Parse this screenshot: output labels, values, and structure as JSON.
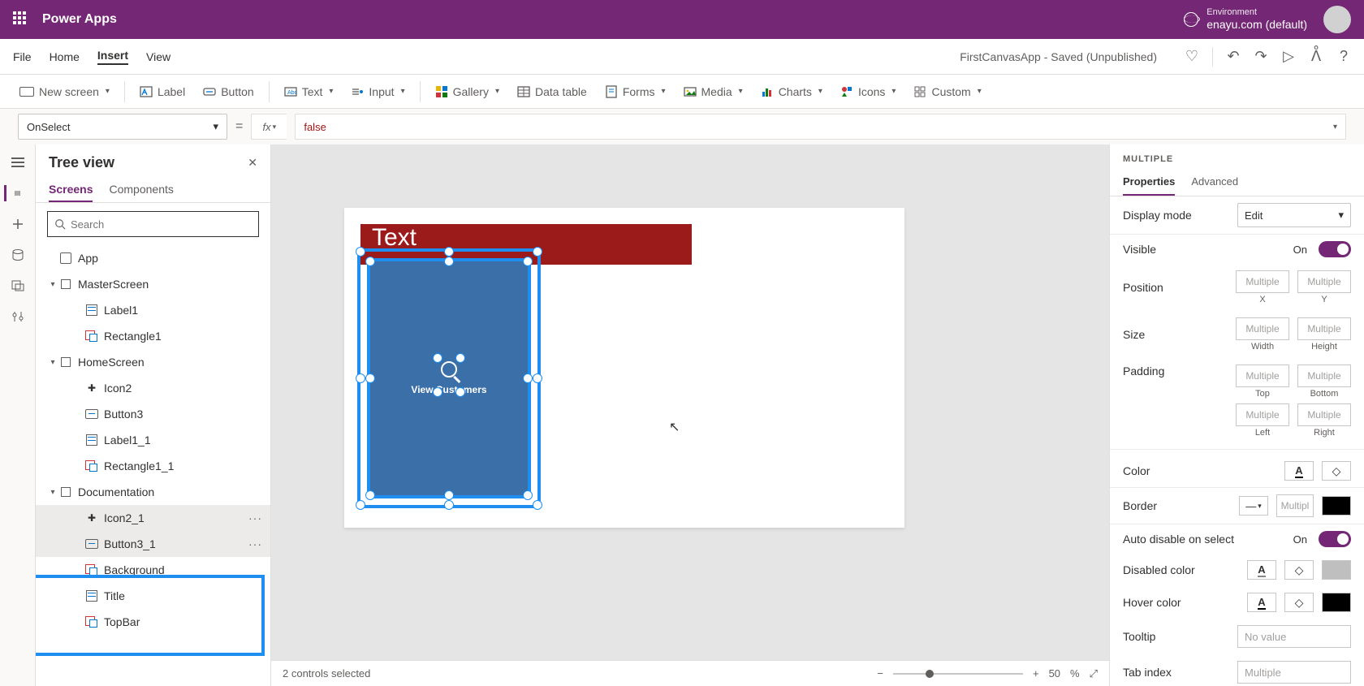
{
  "titlebar": {
    "app": "Power Apps",
    "env_label": "Environment",
    "env_name": "enayu.com (default)"
  },
  "menu": {
    "file": "File",
    "home": "Home",
    "insert": "Insert",
    "view": "View",
    "doc_title": "FirstCanvasApp - Saved (Unpublished)"
  },
  "ribbon": {
    "new_screen": "New screen",
    "label": "Label",
    "button": "Button",
    "text": "Text",
    "input": "Input",
    "gallery": "Gallery",
    "data_table": "Data table",
    "forms": "Forms",
    "media": "Media",
    "charts": "Charts",
    "icons": "Icons",
    "custom": "Custom"
  },
  "formula": {
    "property": "OnSelect",
    "value": "false"
  },
  "tree": {
    "title": "Tree view",
    "tab_screens": "Screens",
    "tab_components": "Components",
    "search_ph": "Search",
    "nodes": {
      "app": "App",
      "master": "MasterScreen",
      "label1": "Label1",
      "rect1": "Rectangle1",
      "home": "HomeScreen",
      "icon2": "Icon2",
      "button3": "Button3",
      "label1_1": "Label1_1",
      "rect1_1": "Rectangle1_1",
      "documentation": "Documentation",
      "icon2_1": "Icon2_1",
      "button3_1": "Button3_1",
      "background": "Background",
      "title": "Title",
      "topbar": "TopBar"
    }
  },
  "canvas": {
    "red_text": "Text",
    "btn_label": "View Customers"
  },
  "status": {
    "selection": "2 controls selected",
    "zoom_value": "50",
    "zoom_pct": "%"
  },
  "props": {
    "panel_title": "MULTIPLE",
    "tab_properties": "Properties",
    "tab_advanced": "Advanced",
    "display_mode": "Display mode",
    "display_mode_val": "Edit",
    "visible": "Visible",
    "visible_val": "On",
    "position": "Position",
    "x": "X",
    "y": "Y",
    "size": "Size",
    "width": "Width",
    "height": "Height",
    "padding": "Padding",
    "top": "Top",
    "bottom": "Bottom",
    "left": "Left",
    "right": "Right",
    "multi": "Multiple",
    "multi_short": "Multipl",
    "color": "Color",
    "border": "Border",
    "auto_disable": "Auto disable on select",
    "auto_disable_val": "On",
    "disabled_color": "Disabled color",
    "hover_color": "Hover color",
    "tooltip": "Tooltip",
    "tooltip_val": "No value",
    "tab_index": "Tab index"
  }
}
